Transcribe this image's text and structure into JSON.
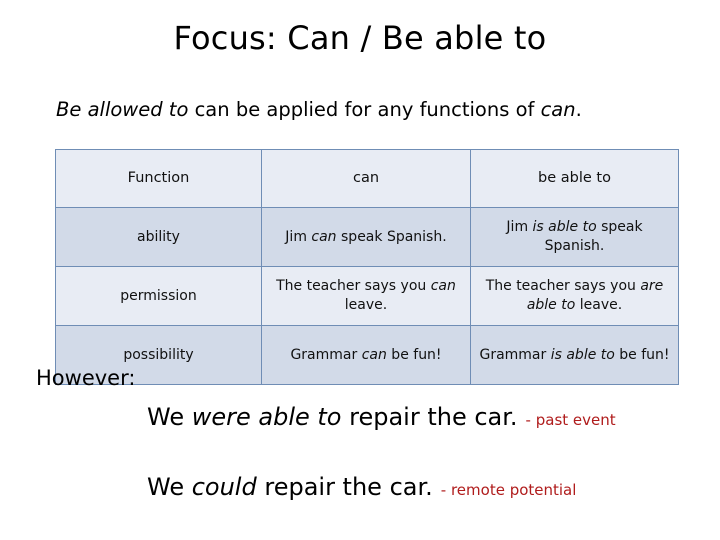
{
  "slide": {
    "title": "Focus: Can / Be able to",
    "intro": {
      "part1_italic": "Be allowed to",
      "part2": " can be applied for any functions of ",
      "part3_italic": "can",
      "part4": "."
    },
    "table": {
      "headers": [
        "Function",
        "can",
        "be able to"
      ],
      "rows": [
        {
          "function": "ability",
          "can": {
            "pre": "Jim ",
            "italic": "can",
            "post": " speak Spanish."
          },
          "be_able_to": {
            "pre": "Jim ",
            "italic": "is able to",
            "post": " speak Spanish."
          }
        },
        {
          "function": "permission",
          "can": {
            "pre": "The teacher says you ",
            "italic": "can",
            "post": " leave."
          },
          "be_able_to": {
            "pre": "The teacher says you ",
            "italic": "are able to",
            "post": " leave."
          }
        },
        {
          "function": "possibility",
          "can": {
            "pre": "Grammar ",
            "italic": "can",
            "post": " be fun!"
          },
          "be_able_to": {
            "pre": "Grammar ",
            "italic": "is able to",
            "post": " be fun!"
          }
        }
      ]
    },
    "however_label": "However:",
    "examples": [
      {
        "pre": "We ",
        "italic": "were able to",
        "post": " repair the car.",
        "annotation": "- past event"
      },
      {
        "pre": "We ",
        "italic": "could",
        "post": " repair the car.",
        "annotation": "- remote potential"
      }
    ]
  },
  "colors": {
    "table_border": "#6f8db5",
    "header_fill": "#e8ecf4",
    "row_dark_fill": "#d2dae8",
    "row_light_fill": "#e8ecf4",
    "annotation_red": "#b01c1c",
    "text": "#000000",
    "background": "#ffffff"
  }
}
